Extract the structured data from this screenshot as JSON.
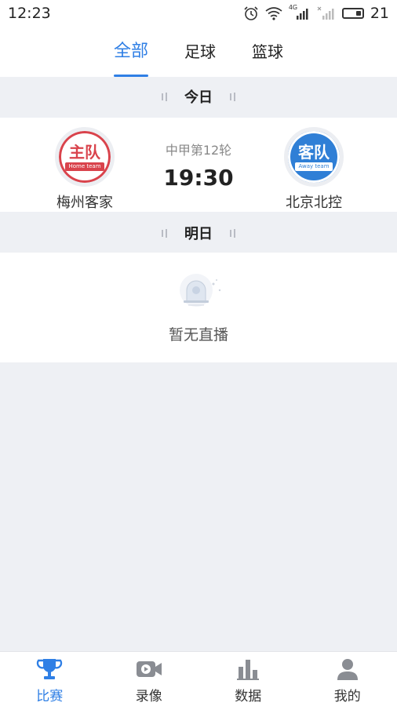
{
  "status_bar": {
    "time": "12:23",
    "network": "4G",
    "battery": "21"
  },
  "tabs": [
    {
      "label": "全部",
      "active": true
    },
    {
      "label": "足球",
      "active": false
    },
    {
      "label": "篮球",
      "active": false
    }
  ],
  "sections": {
    "today": {
      "title": "今日"
    },
    "tomorrow": {
      "title": "明日"
    }
  },
  "match": {
    "league": "中甲第12轮",
    "time": "19:30",
    "home": {
      "logo_main": "主队",
      "logo_sub": "Home team",
      "name": "梅州客家"
    },
    "away": {
      "logo_main": "客队",
      "logo_sub": "Away team",
      "name": "北京北控"
    }
  },
  "empty_state": {
    "text": "暂无直播",
    "icon": "broadcast-icon"
  },
  "bottom_nav": [
    {
      "label": "比赛",
      "icon": "trophy-icon",
      "active": true
    },
    {
      "label": "录像",
      "icon": "video-icon",
      "active": false
    },
    {
      "label": "数据",
      "icon": "chart-icon",
      "active": false
    },
    {
      "label": "我的",
      "icon": "person-icon",
      "active": false
    }
  ],
  "colors": {
    "accent": "#2f7fe5",
    "home": "#d9434c",
    "away": "#2f7fd6"
  }
}
